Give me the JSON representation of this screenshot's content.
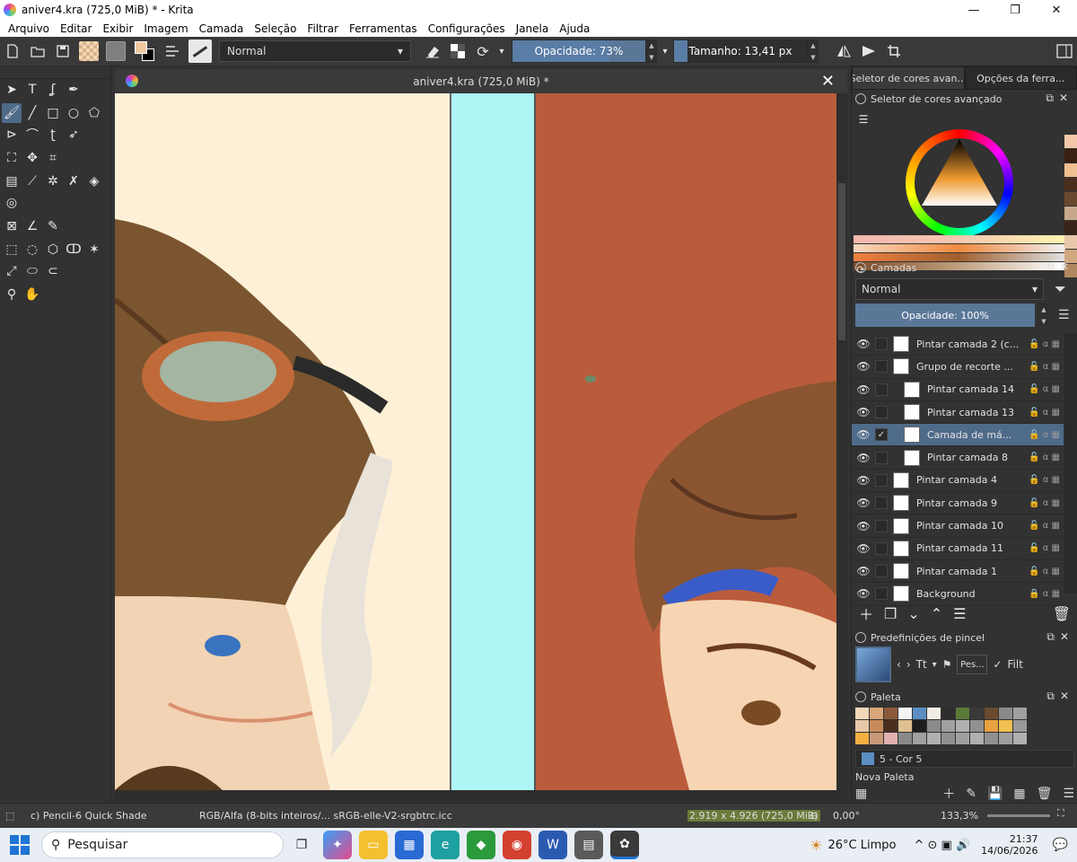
{
  "window": {
    "title": "aniver4.kra (725,0 MiB) * - Krita",
    "minimize": "—",
    "maximize": "❐",
    "close": "✕"
  },
  "menu": [
    "Arquivo",
    "Editar",
    "Exibir",
    "Imagem",
    "Camada",
    "Seleção",
    "Filtrar",
    "Ferramentas",
    "Configurações",
    "Janela",
    "Ajuda"
  ],
  "toolbar": {
    "blend_mode": "Normal",
    "opacity_label": "Opacidade: 73%",
    "opacity_value": 0.73,
    "size_label": "Tamanho: 13,41 px",
    "size_fill": 0.1
  },
  "document": {
    "tab_title": "aniver4.kra (725,0 MiB) *",
    "close": "✕"
  },
  "dock_tabs": [
    "Seletor de cores avan...",
    "Opções da ferra..."
  ],
  "color_selector": {
    "title": "Seletor de cores avançado"
  },
  "layers_panel": {
    "title": "Camadas",
    "blend_mode": "Normal",
    "opacity_label": "Opacidade:  100%",
    "layers": [
      {
        "name": "Pintar camada 2 (c...",
        "indent": 0,
        "selected": false,
        "checked": false,
        "locked": false
      },
      {
        "name": "Grupo de recorte ...",
        "indent": 0,
        "selected": false,
        "checked": false,
        "locked": false
      },
      {
        "name": "Pintar camada 14",
        "indent": 1,
        "selected": false,
        "checked": false,
        "locked": false
      },
      {
        "name": "Pintar camada 13",
        "indent": 1,
        "selected": false,
        "checked": false,
        "locked": false
      },
      {
        "name": "Camada de má...",
        "indent": 1,
        "selected": true,
        "checked": true,
        "locked": false
      },
      {
        "name": "Pintar camada 8",
        "indent": 1,
        "selected": false,
        "checked": false,
        "locked": false
      },
      {
        "name": "Pintar camada 4",
        "indent": 0,
        "selected": false,
        "checked": false,
        "locked": false
      },
      {
        "name": "Pintar camada 9",
        "indent": 0,
        "selected": false,
        "checked": false,
        "locked": false
      },
      {
        "name": "Pintar camada 10",
        "indent": 0,
        "selected": false,
        "checked": false,
        "locked": false
      },
      {
        "name": "Pintar camada 11",
        "indent": 0,
        "selected": false,
        "checked": false,
        "locked": false
      },
      {
        "name": "Pintar camada 1",
        "indent": 0,
        "selected": false,
        "checked": false,
        "locked": false
      },
      {
        "name": "Background",
        "indent": 0,
        "selected": false,
        "checked": false,
        "locked": true
      }
    ]
  },
  "brush_presets": {
    "title": "Predefinições de pincel",
    "search_placeholder": "Pes...",
    "tag_short": "Tt",
    "filter_short": "Filt"
  },
  "palette": {
    "title": "Paleta",
    "current_color": "5 - Cor 5",
    "palette_name": "Nova Paleta",
    "colors": [
      "#f2d6b8",
      "#d9a77a",
      "#8a5a3a",
      "#f4f4f4",
      "#5b8fc2",
      "#f0ece4",
      "#2e2e2e",
      "#5a7a3a",
      "#3a3a3a",
      "#6b4a2e",
      "#8a8a8a",
      "#a0a0a0",
      "#e8c8a8",
      "#c98a5a",
      "#4a2e1e",
      "#e0c090",
      "#1e1e1e",
      "#8a8a8a",
      "#a0a0a0",
      "#b0b0b0",
      "#909090",
      "#e8a040",
      "#f0c050",
      "#9a9a9a",
      "#f4b040",
      "#c89a7a",
      "#e0b0b0",
      "#8a8a8a",
      "#a0a0a0",
      "#b0b0b0",
      "#909090",
      "#a0a0a0",
      "#b0b0b0",
      "#909090",
      "#a0a0a0",
      "#b0b0b0"
    ]
  },
  "status": {
    "brush": "c) Pencil-6 Quick Shade",
    "color_space": "RGB/Alfa (8-bits inteiros/...  sRGB-elle-V2-srgbtrc.icc",
    "dimensions": "2.919 x 4.926 (725,0 MiB)",
    "rotation": "0,00°",
    "zoom": "133,3%"
  },
  "taskbar": {
    "search_label": "Pesquisar",
    "weather": "26°C  Limpo",
    "time": "21:37",
    "date": "14/06/2026"
  },
  "colors": {
    "accent": "#5a7797",
    "selected": "#4f6b8a",
    "canvas_left_bg": "#fdf0d6",
    "canvas_cyan": "#aef5f5",
    "canvas_right_bg": "#ba5c3c"
  }
}
